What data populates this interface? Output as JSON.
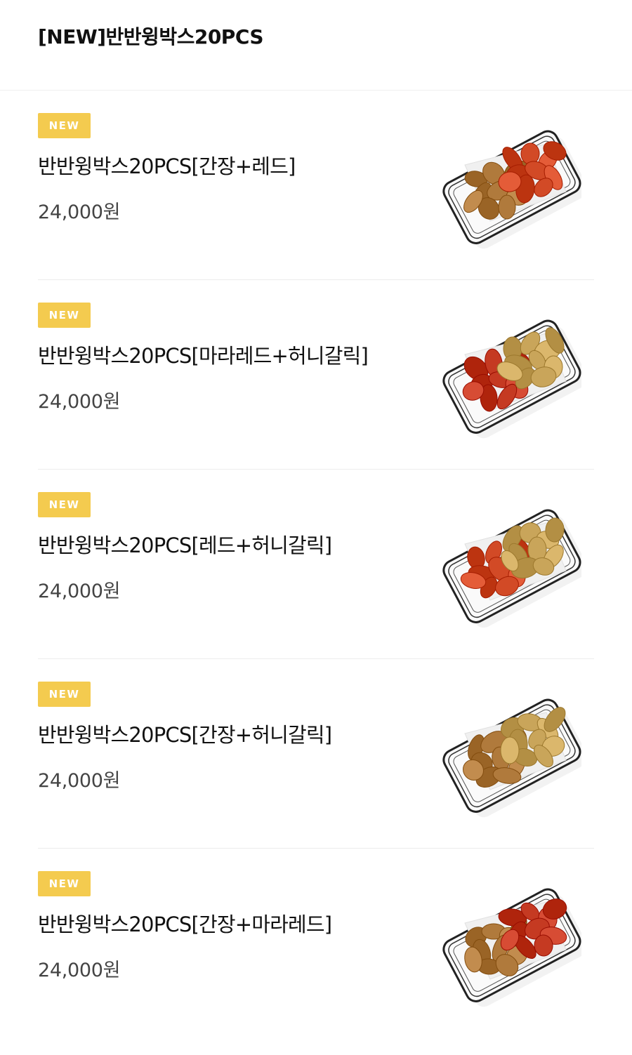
{
  "header": {
    "title": "[NEW]반반윙박스20PCS"
  },
  "colors": {
    "badge": "#f4cb4f",
    "soy": "#b07a3c",
    "red": "#d24a26",
    "marared": "#c53a22",
    "honeygarlic": "#c9a55a"
  },
  "menu": {
    "items": [
      {
        "badge": "NEW",
        "name": "반반윙박스20PCS[간장+레드]",
        "price": "24,000원",
        "image_icon": "chicken-wings-basket-icon",
        "left_flavor": "soy",
        "right_flavor": "red"
      },
      {
        "badge": "NEW",
        "name": "반반윙박스20PCS[마라레드+허니갈릭]",
        "price": "24,000원",
        "image_icon": "chicken-wings-basket-icon",
        "left_flavor": "marared",
        "right_flavor": "honeygarlic"
      },
      {
        "badge": "NEW",
        "name": "반반윙박스20PCS[레드+허니갈릭]",
        "price": "24,000원",
        "image_icon": "chicken-wings-basket-icon",
        "left_flavor": "red",
        "right_flavor": "honeygarlic"
      },
      {
        "badge": "NEW",
        "name": "반반윙박스20PCS[간장+허니갈릭]",
        "price": "24,000원",
        "image_icon": "chicken-wings-basket-icon",
        "left_flavor": "soy",
        "right_flavor": "honeygarlic"
      },
      {
        "badge": "NEW",
        "name": "반반윙박스20PCS[간장+마라레드]",
        "price": "24,000원",
        "image_icon": "chicken-wings-basket-icon",
        "left_flavor": "soy",
        "right_flavor": "marared"
      }
    ]
  }
}
